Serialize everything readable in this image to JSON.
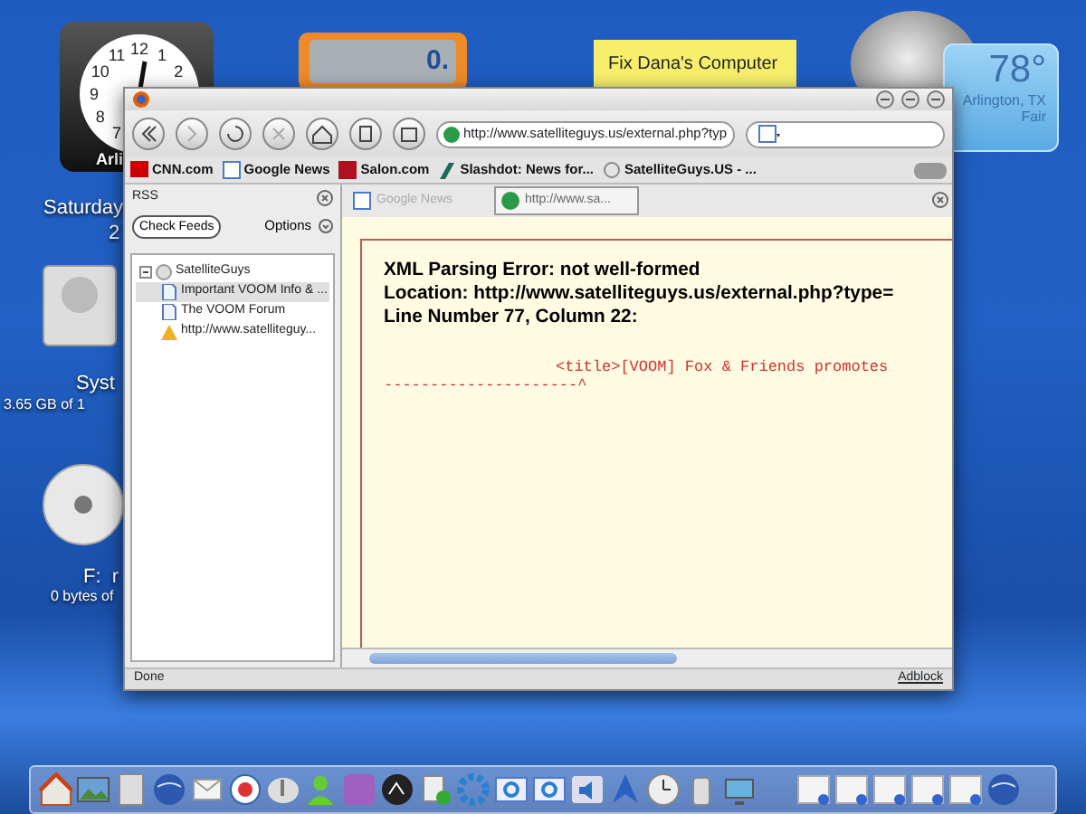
{
  "desktop": {
    "clock": {
      "numerals": [
        "12",
        "11",
        "1",
        "10",
        "2",
        "9",
        "8",
        "7"
      ],
      "label": "Arli"
    },
    "calculator": {
      "display": "0."
    },
    "sticky_note": {
      "text": "Fix Dana's Computer"
    },
    "weather": {
      "temperature": "78°",
      "location": "Arlington, TX",
      "condition": "Fair"
    },
    "date": {
      "day": "Saturday",
      "line_2": "2"
    },
    "icons": [
      {
        "kind": "drive",
        "name": "Syst",
        "detail": "3.65 GB of 1"
      },
      {
        "kind": "disc",
        "name": "F:  r",
        "detail": "0 bytes of"
      }
    ]
  },
  "browser": {
    "url": "http://www.satelliteguys.us/external.php?typ",
    "bookmarks": [
      {
        "kind": "cnn",
        "label": "CNN.com"
      },
      {
        "kind": "google",
        "label": "Google News"
      },
      {
        "kind": "salon",
        "label": "Salon.com"
      },
      {
        "kind": "slashdot",
        "label": "Slashdot: News for..."
      },
      {
        "kind": "generic",
        "label": "SatelliteGuys.US - ..."
      }
    ],
    "sidebar": {
      "title": "RSS",
      "check_button": "Check Feeds",
      "options": "Options",
      "tree": [
        {
          "label": "SatelliteGuys",
          "kind": "folder",
          "expanded": true,
          "selected": false,
          "children": [
            {
              "label": "Important VOOM Info & ...",
              "kind": "page",
              "selected": true
            },
            {
              "label": "The VOOM Forum",
              "kind": "page",
              "selected": false
            },
            {
              "label": "http://www.satelliteguy...",
              "kind": "warning",
              "selected": false
            }
          ]
        }
      ]
    },
    "tabs": [
      {
        "label": "Google News",
        "kind": "google",
        "selected": false
      },
      {
        "label": "http://www.sa...",
        "kind": "globe",
        "selected": true
      }
    ],
    "error": {
      "lines": [
        "XML Parsing Error: not well-formed",
        "Location: http://www.satelliteguys.us/external.php?type=",
        "Line Number 77, Column 22:"
      ],
      "source_line": "<title>[VOOM] Fox & Friends promotes",
      "marker_line": "---------------------^"
    },
    "status": "Done",
    "adblock": "Adblock"
  },
  "dock": [
    {
      "kind": "home"
    },
    {
      "kind": "picture"
    },
    {
      "kind": "calculator"
    },
    {
      "kind": "globe"
    },
    {
      "kind": "mail"
    },
    {
      "kind": "camera"
    },
    {
      "kind": "music"
    },
    {
      "kind": "people"
    },
    {
      "kind": "purple"
    },
    {
      "kind": "dark"
    },
    {
      "kind": "files"
    },
    {
      "kind": "gear"
    },
    {
      "kind": "window"
    },
    {
      "kind": "window"
    },
    {
      "kind": "speaker"
    },
    {
      "kind": "arrow"
    },
    {
      "kind": "clock"
    },
    {
      "kind": "trash"
    },
    {
      "kind": "monitor"
    },
    {
      "kind": "sep"
    },
    {
      "kind": "doc"
    },
    {
      "kind": "doc"
    },
    {
      "kind": "doc"
    },
    {
      "kind": "doc"
    },
    {
      "kind": "doc"
    },
    {
      "kind": "globe"
    }
  ]
}
